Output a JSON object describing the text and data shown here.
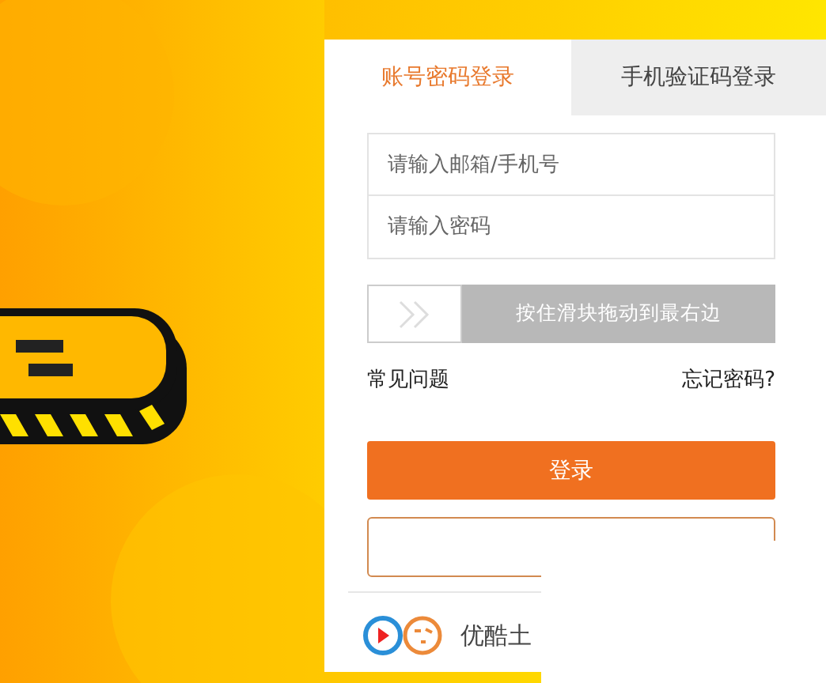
{
  "tabs": [
    {
      "label": "账号密码登录",
      "selected": true
    },
    {
      "label": "手机验证码登录",
      "selected": false
    }
  ],
  "fields": [
    {
      "placeholder": "请输入邮箱/手机号"
    },
    {
      "placeholder": "请输入密码"
    }
  ],
  "slider": {
    "label": "按住滑块拖动到最右边",
    "level": 0
  },
  "links": {
    "faq": "常见问题",
    "forgot": "忘记密码?"
  },
  "login_button": "登录",
  "footer": {
    "brand": "优酷土"
  }
}
